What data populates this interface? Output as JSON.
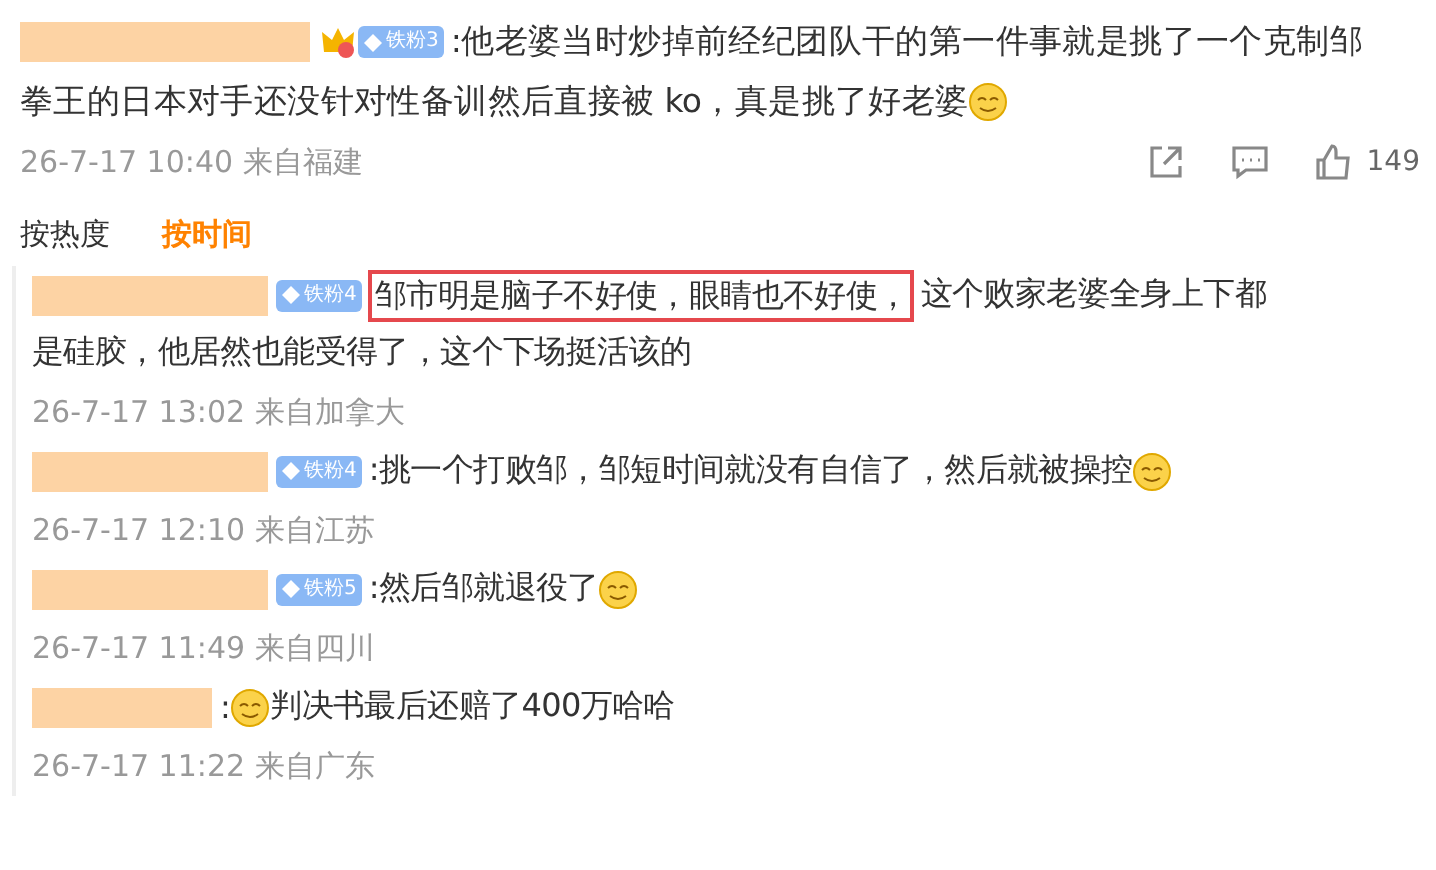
{
  "comment": {
    "badge": "铁粉3",
    "lines": [
      [
        {
          "kind": "text",
          "text": ":他老婆当时炒掉前经纪团队干的第一件事就是挑了一个克制邹"
        }
      ],
      [
        {
          "kind": "text",
          "text": "拳王的日本对手还没针对性备训然后直接被 ko，真是挑了好老婆"
        },
        {
          "kind": "emoji"
        }
      ]
    ],
    "meta": "26-7-17 10:40 来自福建",
    "likes": "149"
  },
  "sort_tabs": [
    {
      "label": "按热度",
      "selected": false
    },
    {
      "label": "按时间",
      "selected": true
    }
  ],
  "replies": [
    {
      "badge": "铁粉4",
      "lines": [
        [
          {
            "kind": "highlight",
            "text": "邹市明是脑子不好使，眼睛也不好使，"
          },
          {
            "kind": "text",
            "text": "这个败家老婆全身上下都"
          }
        ],
        [
          {
            "kind": "text",
            "text": "是硅胶，他居然也能受得了，这个下场挺活该的"
          }
        ]
      ],
      "meta": "26-7-17 13:02 来自加拿大"
    },
    {
      "badge": "铁粉4",
      "lines": [
        [
          {
            "kind": "text",
            "text": ":挑一个打败邹，邹短时间就没有自信了，然后就被操控"
          },
          {
            "kind": "emoji"
          }
        ]
      ],
      "meta": "26-7-17 12:10 来自江苏"
    },
    {
      "badge": "铁粉5",
      "lines": [
        [
          {
            "kind": "text",
            "text": ":然后邹就退役了"
          },
          {
            "kind": "emoji"
          }
        ]
      ],
      "meta": "26-7-17 11:49 来自四川"
    },
    {
      "lines": [
        [
          {
            "kind": "text",
            "text": ":"
          },
          {
            "kind": "emoji"
          },
          {
            "kind": "text",
            "text": "判决书最后还赔了400万哈哈"
          }
        ]
      ],
      "meta": "26-7-17 11:22 来自广东"
    }
  ]
}
